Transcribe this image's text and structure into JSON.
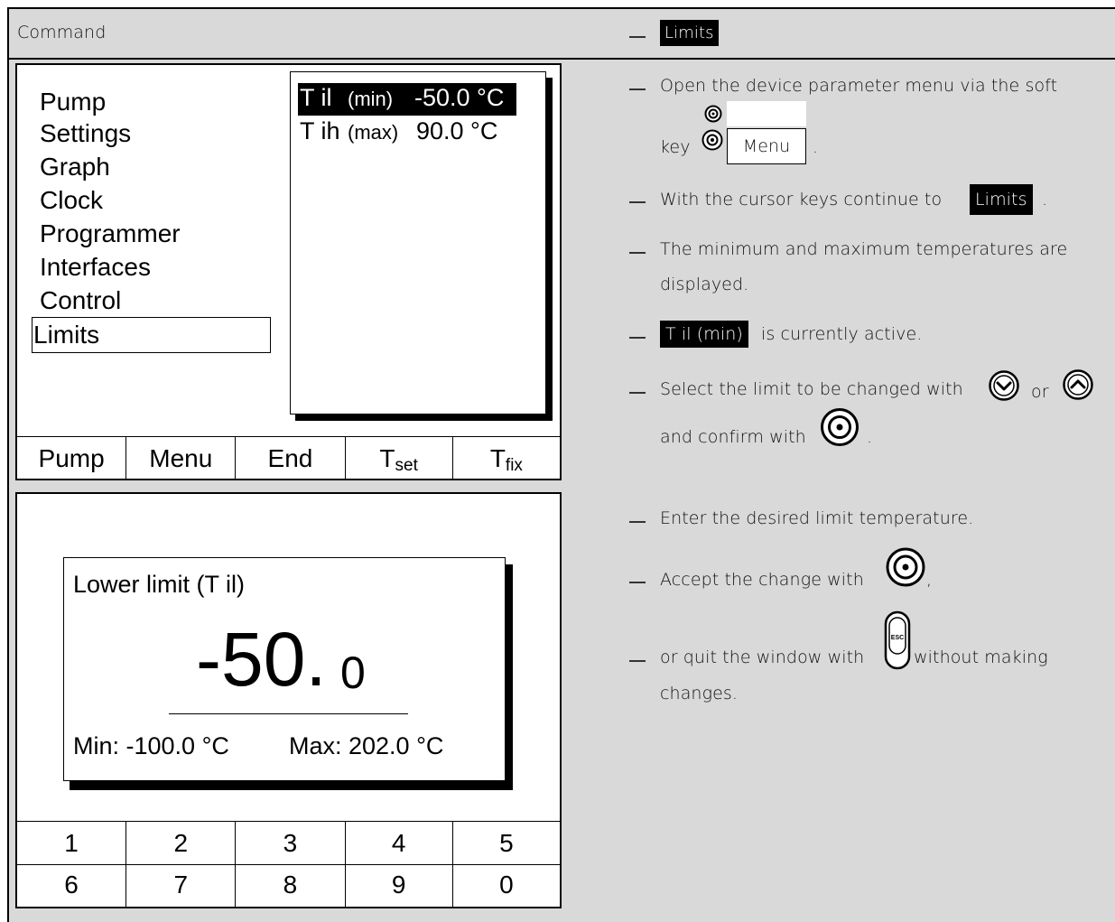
{
  "header": {
    "command_label": "Command",
    "limits_tag": "Limits"
  },
  "screen1": {
    "menu_items": [
      "Pump",
      "Settings",
      "Graph",
      "Clock",
      "Programmer",
      "Interfaces",
      "Control",
      "Limits"
    ],
    "selected_item": "Limits",
    "limits": [
      {
        "name": "T il",
        "qualifier": "(min)",
        "value": "-50.0 °C",
        "highlighted": true
      },
      {
        "name": "T ih",
        "qualifier": "(max)",
        "value": "90.0 °C",
        "highlighted": false
      }
    ],
    "softkeys": [
      "Pump",
      "Menu",
      "End",
      "T",
      "T"
    ],
    "softkey_subscripts": [
      "",
      "",
      "",
      "set",
      "fix"
    ]
  },
  "screen2": {
    "dialog_title": "Lower limit (T il)",
    "value_main": "-50.",
    "value_decimal": "0",
    "min_label": "Min: -100.0 °C",
    "max_label": "Max: 202.0 °C",
    "keypad_row1": [
      "1",
      "2",
      "3",
      "4",
      "5"
    ],
    "keypad_row2": [
      "6",
      "7",
      "8",
      "9",
      "0"
    ]
  },
  "instructions": {
    "step1_text": "Open the device parameter menu via the soft",
    "step1_key_prefix": "key",
    "step1_menu_button": "Menu",
    "step1_suffix": ".",
    "step2_text": "With the cursor keys continue to",
    "step2_tag": "Limits",
    "step2_suffix": ".",
    "step3_line1": "The minimum and maximum temperatures are",
    "step3_line2": "displayed.",
    "step4_tag": "T il (min)",
    "step4_text": "is currently active.",
    "step5_text_a": "Select the limit to be changed with",
    "step5_or": "or",
    "step5_text_b": "and confirm with",
    "step5_suffix": ".",
    "step6_text": "Enter the desired limit temperature.",
    "step7_text": "Accept the change with",
    "step7_suffix": ",",
    "step8_text_a": "or quit the window with",
    "step8_text_b": "without making",
    "step8_line2": "changes."
  },
  "icons": {
    "enter": "enter-knob-icon",
    "down": "arrow-down-circle-icon",
    "up": "arrow-up-circle-icon",
    "esc": "esc-key-icon"
  }
}
